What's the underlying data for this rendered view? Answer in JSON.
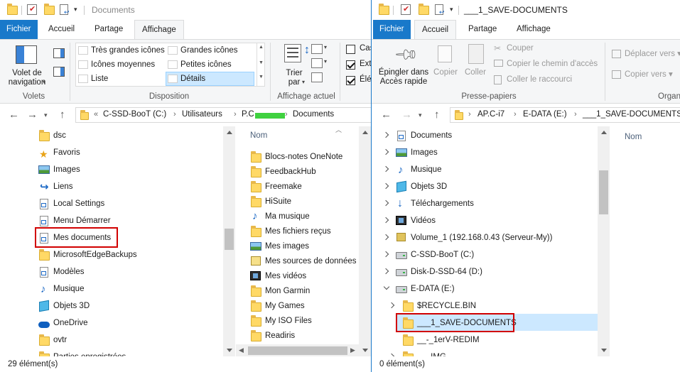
{
  "left": {
    "title": "Documents",
    "tabs": [
      "Fichier",
      "Accueil",
      "Partage",
      "Affichage"
    ],
    "ribbon": {
      "nav_pane_label": [
        "Volet de",
        "navigation"
      ],
      "group_volets": "Volets",
      "layouts": [
        "Très grandes icônes",
        "Grandes icônes",
        "Icônes moyennes",
        "Petites icônes",
        "Liste",
        "Détails"
      ],
      "group_disposition": "Disposition",
      "sort_label": [
        "Trier",
        "par"
      ],
      "group_affichage": "Affichage actuel",
      "checkboxes": [
        "Cas",
        "Ext",
        "Élé"
      ]
    },
    "address": {
      "prefix": "«",
      "crumbs": [
        "C-SSD-BooT (C:)",
        "Utilisateurs",
        "P.C",
        "Documents"
      ]
    },
    "tree": [
      {
        "label": "dsc",
        "icon": "folder-icon"
      },
      {
        "label": "Favoris",
        "icon": "star-icon"
      },
      {
        "label": "Images",
        "icon": "pictures-icon"
      },
      {
        "label": "Liens",
        "icon": "link-icon"
      },
      {
        "label": "Local Settings",
        "icon": "shortcut-folder-icon"
      },
      {
        "label": "Menu Démarrer",
        "icon": "shortcut-folder-icon"
      },
      {
        "label": "Mes documents",
        "icon": "shortcut-folder-icon"
      },
      {
        "label": "MicrosoftEdgeBackups",
        "icon": "folder-icon"
      },
      {
        "label": "Modèles",
        "icon": "shortcut-folder-icon"
      },
      {
        "label": "Musique",
        "icon": "music-icon"
      },
      {
        "label": "Objets 3D",
        "icon": "cube-icon"
      },
      {
        "label": "OneDrive",
        "icon": "onedrive-icon"
      },
      {
        "label": "ovtr",
        "icon": "folder-icon"
      },
      {
        "label": "Parties enregistrées",
        "icon": "folder-icon"
      }
    ],
    "files_header": "Nom",
    "files": [
      {
        "label": "Blocs-notes OneNote",
        "icon": "folder-icon"
      },
      {
        "label": "FeedbackHub",
        "icon": "folder-icon"
      },
      {
        "label": "Freemake",
        "icon": "folder-icon"
      },
      {
        "label": "HiSuite",
        "icon": "folder-icon"
      },
      {
        "label": "Ma musique",
        "icon": "music-shortcut-icon"
      },
      {
        "label": "Mes fichiers reçus",
        "icon": "folder-icon"
      },
      {
        "label": "Mes images",
        "icon": "pictures-shortcut-icon"
      },
      {
        "label": "Mes sources de données",
        "icon": "datasource-icon"
      },
      {
        "label": "Mes vidéos",
        "icon": "video-shortcut-icon"
      },
      {
        "label": "Mon Garmin",
        "icon": "folder-icon"
      },
      {
        "label": "My Games",
        "icon": "folder-icon"
      },
      {
        "label": "My ISO Files",
        "icon": "folder-icon"
      },
      {
        "label": "Readiris",
        "icon": "folder-icon"
      }
    ],
    "status": "29 élément(s)"
  },
  "right": {
    "title": "___1_SAVE-DOCUMENTS",
    "tabs": [
      "Fichier",
      "Accueil",
      "Partage",
      "Affichage"
    ],
    "ribbon": {
      "pin_label": [
        "Épingler dans",
        "Accès rapide"
      ],
      "copy": "Copier",
      "paste": "Coller",
      "cut": "Couper",
      "copy_path": "Copier le chemin d'accès",
      "paste_shortcut": "Coller le raccourci",
      "group_presse": "Presse-papiers",
      "move_to": "Déplacer vers",
      "copy_to": "Copier vers",
      "group_org": "Organ"
    },
    "address": {
      "crumbs": [
        "AP.C-i7",
        "E-DATA (E:)",
        "___1_SAVE-DOCUMENTS"
      ]
    },
    "tree": [
      {
        "label": "Documents",
        "icon": "documents-icon",
        "indent": 0,
        "exp": "r"
      },
      {
        "label": "Images",
        "icon": "pictures-icon",
        "indent": 0,
        "exp": "r"
      },
      {
        "label": "Musique",
        "icon": "music-icon",
        "indent": 0,
        "exp": "r"
      },
      {
        "label": "Objets 3D",
        "icon": "cube-icon",
        "indent": 0,
        "exp": "r"
      },
      {
        "label": "Téléchargements",
        "icon": "download-icon",
        "indent": 0,
        "exp": "r"
      },
      {
        "label": "Vidéos",
        "icon": "video-icon",
        "indent": 0,
        "exp": "r"
      },
      {
        "label": "Volume_1 (192.168.0.43 (Serveur-My))",
        "icon": "network-drive-icon",
        "indent": 0,
        "exp": "r"
      },
      {
        "label": "C-SSD-BooT (C:)",
        "icon": "drive-icon",
        "indent": 0,
        "exp": "r"
      },
      {
        "label": "Disk-D-SSD-64 (D:)",
        "icon": "drive-icon",
        "indent": 0,
        "exp": "r"
      },
      {
        "label": "E-DATA (E:)",
        "icon": "drive-icon",
        "indent": 0,
        "exp": "d"
      },
      {
        "label": "$RECYCLE.BIN",
        "icon": "folder-icon",
        "indent": 1,
        "exp": "r"
      },
      {
        "label": "___1_SAVE-DOCUMENTS",
        "icon": "folder-icon",
        "indent": 1,
        "exp": ""
      },
      {
        "label": "__-_1erV-REDIM",
        "icon": "folder-icon",
        "indent": 1,
        "exp": ""
      },
      {
        "label": "___IMG",
        "icon": "folder-icon",
        "indent": 1,
        "exp": "r"
      }
    ],
    "files_header": "Nom",
    "status": "0 élément(s)"
  }
}
